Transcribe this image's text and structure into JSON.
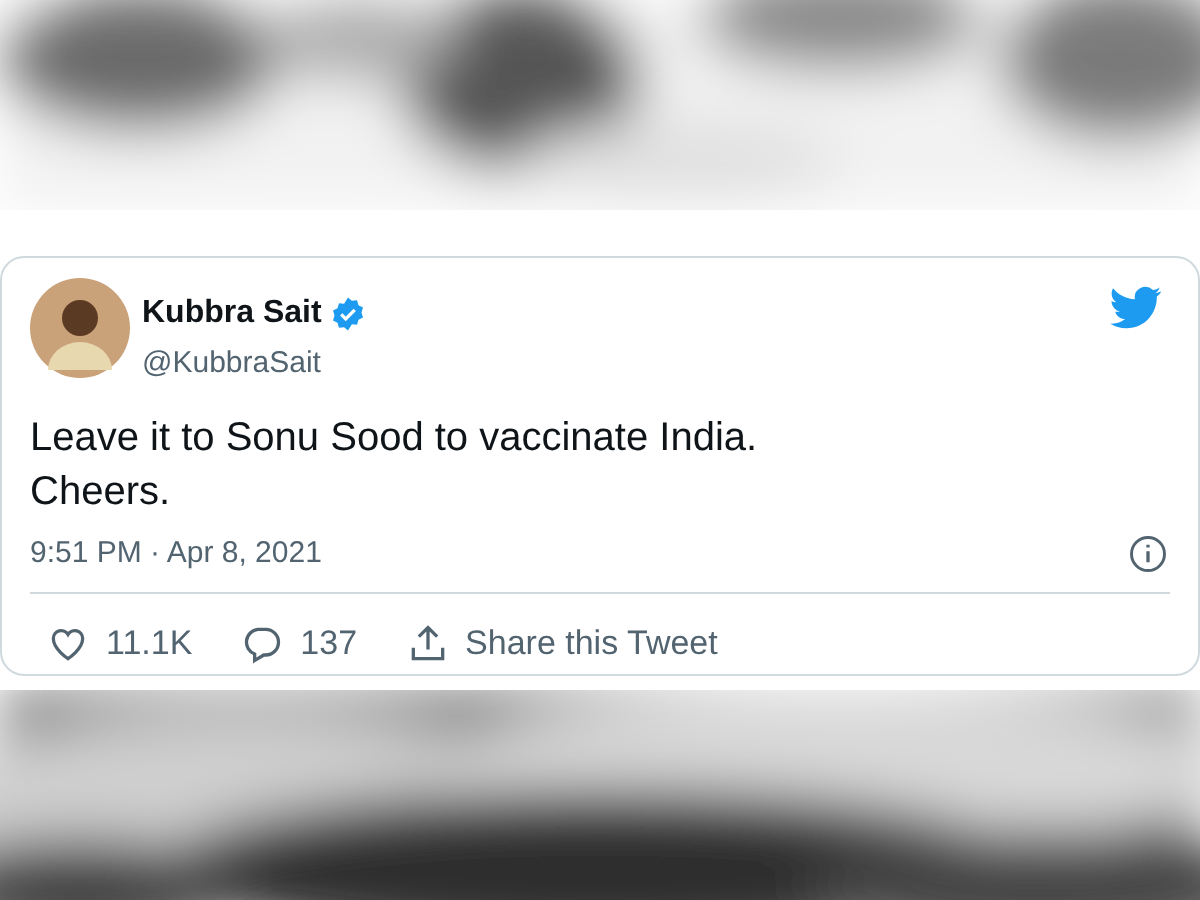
{
  "tweet": {
    "author": {
      "name": "Kubbra Sait",
      "handle": "@KubbraSait",
      "verified": true
    },
    "text_lines": [
      "Leave it to Sonu Sood to vaccinate India.",
      "Cheers."
    ],
    "timestamp": "9:51 PM · Apr 8, 2021",
    "actions": [
      {
        "kind": "like",
        "label": "11.1K"
      },
      {
        "kind": "reply",
        "label": "137"
      },
      {
        "kind": "share",
        "label": "Share this Tweet"
      }
    ]
  }
}
